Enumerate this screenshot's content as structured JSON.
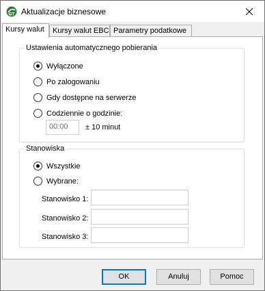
{
  "window": {
    "title": "Aktualizacje biznesowe",
    "icon": "app-logo-icon",
    "close_icon": "close-icon"
  },
  "tabs": [
    {
      "label": "Kursy walut",
      "active": true
    },
    {
      "label": "Kursy walut EBC",
      "active": false
    },
    {
      "label": "Parametry podatkowe",
      "active": false
    }
  ],
  "auto_download": {
    "legend": "Ustawienia automatycznego pobierania",
    "options": [
      {
        "label": "Wyłączone",
        "checked": true
      },
      {
        "label": "Po zalogowaniu",
        "checked": false
      },
      {
        "label": "Gdy dostępne na serwerze",
        "checked": false
      },
      {
        "label": "Codziennie o godzinie:",
        "checked": false
      }
    ],
    "time_value": "00:00",
    "time_tolerance": "± 10 minut"
  },
  "workstations": {
    "legend": "Stanowiska",
    "options": [
      {
        "label": "Wszystkie",
        "checked": true
      },
      {
        "label": "Wybrane:",
        "checked": false
      }
    ],
    "fields": [
      {
        "label": "Stanowisko 1:",
        "value": ""
      },
      {
        "label": "Stanowisko 2:",
        "value": ""
      },
      {
        "label": "Stanowisko 3:",
        "value": ""
      }
    ]
  },
  "buttons": {
    "ok": "OK",
    "cancel": "Anuluj",
    "help": "Pomoc"
  },
  "colors": {
    "focus_border": "#0078d7",
    "titlebar_bg": "#ffffff",
    "dialog_bg": "#f0f0f0"
  }
}
